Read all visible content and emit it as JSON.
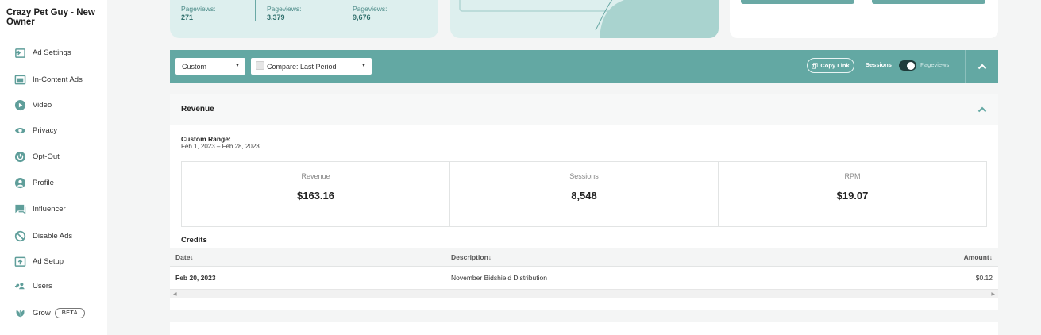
{
  "sidebar": {
    "site_title": "Crazy Pet Guy - New Owner",
    "items": [
      {
        "label": "Ad Settings",
        "icon": "ad-settings-icon"
      },
      {
        "label": "In-Content Ads",
        "icon": "in-content-ads-icon"
      },
      {
        "label": "Video",
        "icon": "video-icon"
      },
      {
        "label": "Privacy",
        "icon": "eye-icon"
      },
      {
        "label": "Opt-Out",
        "icon": "power-icon"
      },
      {
        "label": "Profile",
        "icon": "user-icon"
      },
      {
        "label": "Influencer",
        "icon": "chat-icon"
      },
      {
        "label": "Disable Ads",
        "icon": "block-icon"
      },
      {
        "label": "Ad Setup",
        "icon": "upload-icon"
      },
      {
        "label": "Users",
        "icon": "users-icon"
      },
      {
        "label": "Grow",
        "icon": "leaf-icon",
        "badge": "BETA"
      }
    ]
  },
  "pageview_card": {
    "columns": [
      {
        "label": "Pageviews:",
        "value": "271"
      },
      {
        "label": "Pageviews:",
        "value": "3,379"
      },
      {
        "label": "Pageviews:",
        "value": "9,676"
      }
    ]
  },
  "toolbar": {
    "range_select": "Custom",
    "compare_select": "Compare: Last Period",
    "copy_link": "Copy Link",
    "toggle_left": "Sessions",
    "toggle_right": "Pageviews"
  },
  "revenue": {
    "title": "Revenue",
    "range_label": "Custom Range:",
    "range_value": "Feb 1, 2023 – Feb 28, 2023",
    "stats": [
      {
        "label": "Revenue",
        "value": "$163.16"
      },
      {
        "label": "Sessions",
        "value": "8,548"
      },
      {
        "label": "RPM",
        "value": "$19.07"
      }
    ]
  },
  "credits": {
    "title": "Credits",
    "headers": {
      "date": "Date",
      "description": "Description",
      "amount": "Amount"
    },
    "rows": [
      {
        "date": "Feb 20, 2023",
        "description": "November Bidshield Distribution",
        "amount": "$0.12"
      }
    ]
  },
  "colors": {
    "accent": "#63a8a3",
    "card_bg": "#ddefee",
    "text_teal": "#2f6f6c"
  }
}
